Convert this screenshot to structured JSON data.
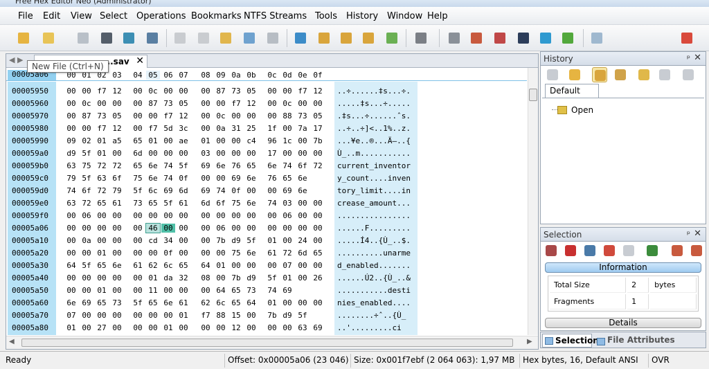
{
  "window": {
    "title": "Free Hex Editor Neo (Administrator)"
  },
  "menu": [
    "File",
    "Edit",
    "View",
    "Select",
    "Operations",
    "Bookmarks",
    "NTFS Streams",
    "Tools",
    "History",
    "Window",
    "Help"
  ],
  "toolbar": {
    "buttons": [
      "new-file",
      "open-file",
      "save-file",
      "save-all",
      "save-as",
      "print",
      "undo",
      "redo",
      "edit",
      "copy",
      "paste",
      "export",
      "find",
      "find-next",
      "find-previous",
      "find-all",
      "go-to",
      "bit-view",
      "tools",
      "pattern",
      "bytes-view",
      "binary-view",
      "full-screen",
      "marker",
      "properties"
    ],
    "tooltip": "New File  (Ctrl+N)"
  },
  "editor": {
    "tab_label": "...sav",
    "columns": [
      "00",
      "01",
      "02",
      "03",
      "04",
      "05",
      "06",
      "07",
      "08",
      "09",
      "0a",
      "0b",
      "0c",
      "0d",
      "0e",
      "0f"
    ],
    "header_offset": "00005a06",
    "rows": [
      {
        "offset": "00005950",
        "bytes": [
          "00",
          "00",
          "f7",
          "12",
          "00",
          "0c",
          "00",
          "00",
          "00",
          "87",
          "73",
          "05",
          "00",
          "00",
          "f7",
          "12"
        ],
        "ascii": "..÷......‡s...÷."
      },
      {
        "offset": "00005960",
        "bytes": [
          "00",
          "0c",
          "00",
          "00",
          "00",
          "87",
          "73",
          "05",
          "00",
          "00",
          "f7",
          "12",
          "00",
          "0c",
          "00",
          "00"
        ],
        "ascii": ".....‡s...÷....."
      },
      {
        "offset": "00005970",
        "bytes": [
          "00",
          "87",
          "73",
          "05",
          "00",
          "00",
          "f7",
          "12",
          "00",
          "0c",
          "00",
          "00",
          "00",
          "88",
          "73",
          "05"
        ],
        "ascii": ".‡s...÷......ˆs."
      },
      {
        "offset": "00005980",
        "bytes": [
          "00",
          "00",
          "f7",
          "12",
          "00",
          "f7",
          "5d",
          "3c",
          "00",
          "0a",
          "31",
          "25",
          "1f",
          "00",
          "7a",
          "17"
        ],
        "ascii": "..÷..÷]<..1%..z."
      },
      {
        "offset": "00005990",
        "bytes": [
          "09",
          "02",
          "01",
          "a5",
          "65",
          "01",
          "00",
          "ae",
          "01",
          "00",
          "00",
          "c4",
          "96",
          "1c",
          "00",
          "7b"
        ],
        "ascii": "...¥e..®...Ä–..{"
      },
      {
        "offset": "000059a0",
        "bytes": [
          "d9",
          "5f",
          "01",
          "00",
          "6d",
          "00",
          "00",
          "00",
          "03",
          "00",
          "00",
          "00",
          "17",
          "00",
          "00",
          "00"
        ],
        "ascii": "Ù_..m..........."
      },
      {
        "offset": "000059b0",
        "bytes": [
          "63",
          "75",
          "72",
          "72",
          "65",
          "6e",
          "74",
          "5f",
          "69",
          "6e",
          "76",
          "65",
          "6e",
          "74",
          "6f",
          "72"
        ],
        "ascii": "current_inventor"
      },
      {
        "offset": "000059c0",
        "bytes": [
          "79",
          "5f",
          "63",
          "6f",
          "75",
          "6e",
          "74",
          "0f",
          "00",
          "00",
          "69",
          "6e",
          "76",
          "65",
          "6e"
        ],
        "ascii": "y_count....inven"
      },
      {
        "offset": "000059d0",
        "bytes": [
          "74",
          "6f",
          "72",
          "79",
          "5f",
          "6c",
          "69",
          "6d",
          "69",
          "74",
          "0f",
          "00",
          "00",
          "69",
          "6e"
        ],
        "ascii": "tory_limit....in"
      },
      {
        "offset": "000059e0",
        "bytes": [
          "63",
          "72",
          "65",
          "61",
          "73",
          "65",
          "5f",
          "61",
          "6d",
          "6f",
          "75",
          "6e",
          "74",
          "03",
          "00",
          "00"
        ],
        "ascii": "crease_amount..."
      },
      {
        "offset": "000059f0",
        "bytes": [
          "00",
          "06",
          "00",
          "00",
          "00",
          "00",
          "00",
          "00",
          "00",
          "00",
          "00",
          "00",
          "00",
          "06",
          "00",
          "00"
        ],
        "ascii": "................"
      },
      {
        "offset": "00005a06",
        "bytes": [
          "00",
          "00",
          "00",
          "00",
          "00",
          "46",
          "00",
          "00",
          "00",
          "06",
          "00",
          "00",
          "00",
          "00",
          "00",
          "00"
        ],
        "ascii": "......F........."
      },
      {
        "offset": "00005a10",
        "bytes": [
          "00",
          "0a",
          "00",
          "00",
          "00",
          "cd",
          "34",
          "00",
          "00",
          "7b",
          "d9",
          "5f",
          "01",
          "00",
          "24",
          "00"
        ],
        "ascii": ".....Í4..{Ù_..$."
      },
      {
        "offset": "00005a20",
        "bytes": [
          "00",
          "00",
          "01",
          "00",
          "00",
          "00",
          "0f",
          "00",
          "00",
          "00",
          "75",
          "6e",
          "61",
          "72",
          "6d",
          "65"
        ],
        "ascii": "..........unarme"
      },
      {
        "offset": "00005a30",
        "bytes": [
          "64",
          "5f",
          "65",
          "6e",
          "61",
          "62",
          "6c",
          "65",
          "64",
          "01",
          "00",
          "00",
          "00",
          "07",
          "00",
          "00"
        ],
        "ascii": "d_enabled......."
      },
      {
        "offset": "00005a40",
        "bytes": [
          "00",
          "00",
          "00",
          "00",
          "00",
          "01",
          "da",
          "32",
          "08",
          "00",
          "7b",
          "d9",
          "5f",
          "01",
          "00",
          "26"
        ],
        "ascii": "......Ú2..{Ù_..&"
      },
      {
        "offset": "00005a50",
        "bytes": [
          "00",
          "00",
          "01",
          "00",
          "00",
          "11",
          "00",
          "00",
          "00",
          "64",
          "65",
          "73",
          "74",
          "69"
        ],
        "ascii": "...........desti"
      },
      {
        "offset": "00005a60",
        "bytes": [
          "6e",
          "69",
          "65",
          "73",
          "5f",
          "65",
          "6e",
          "61",
          "62",
          "6c",
          "65",
          "64",
          "01",
          "00",
          "00",
          "00"
        ],
        "ascii": "nies_enabled...."
      },
      {
        "offset": "00005a70",
        "bytes": [
          "07",
          "00",
          "00",
          "00",
          "00",
          "00",
          "00",
          "01",
          "f7",
          "88",
          "15",
          "00",
          "7b",
          "d9",
          "5f"
        ],
        "ascii": "........÷ˆ..{Ù_"
      },
      {
        "offset": "00005a80",
        "bytes": [
          "01",
          "00",
          "27",
          "00",
          "00",
          "00",
          "01",
          "00",
          "00",
          "00",
          "12",
          "00",
          "00",
          "00",
          "63",
          "69"
        ],
        "ascii": "..'.........ci"
      }
    ]
  },
  "history": {
    "title": "History",
    "tab": "Default",
    "entries": [
      "Open"
    ]
  },
  "selection": {
    "title": "Selection",
    "info_label": "Information",
    "details_label": "Details",
    "rows": [
      {
        "label": "Total Size",
        "value": "2",
        "unit": "bytes"
      },
      {
        "label": "Fragments",
        "value": "1",
        "unit": ""
      }
    ],
    "tabs": [
      "Selection",
      "File Attributes"
    ]
  },
  "status": {
    "ready": "Ready",
    "offset": "Offset: 0x00005a06 (23 046)",
    "size": "Size: 0x001f7ebf (2 064 063): 1,97 MB",
    "mode": "Hex bytes, 16, Default ANSI",
    "ovr": "OVR"
  },
  "colors": {
    "offset_bg": "#b7e2f6",
    "ascii_bg": "#d7eef9",
    "highlight": "#50c0a8"
  }
}
